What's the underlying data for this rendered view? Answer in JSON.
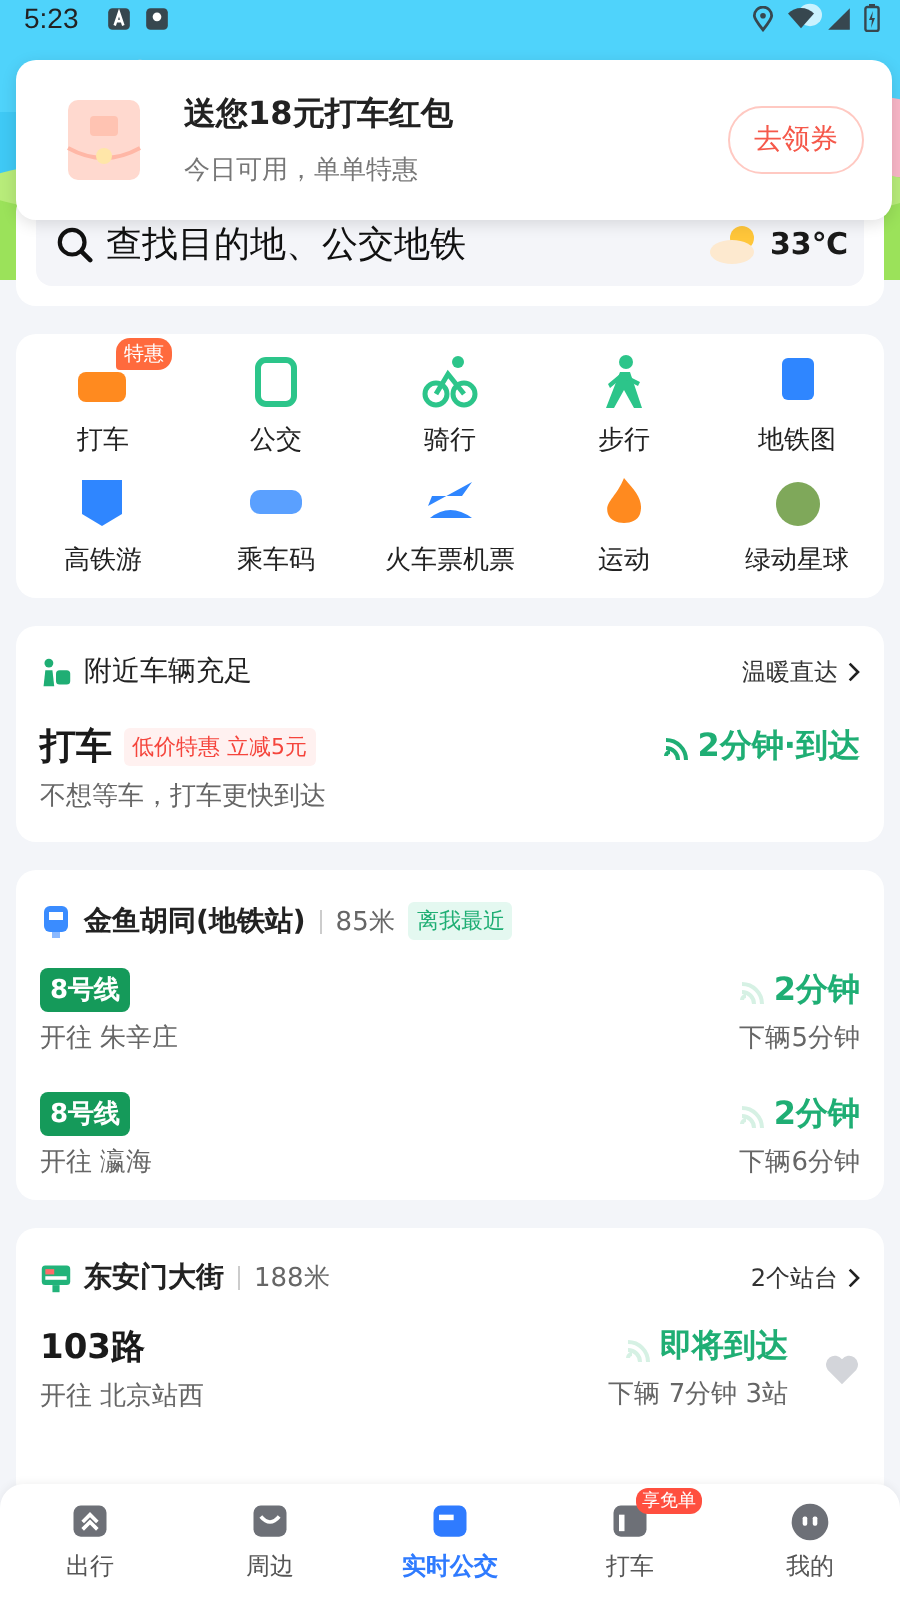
{
  "status_bar": {
    "time": "5:23"
  },
  "notification": {
    "title": "送您18元打车红包",
    "subtitle": "今日可用，单单特惠",
    "button": "去领券"
  },
  "search": {
    "placeholder": "查找目的地、公交地铁",
    "temperature": "33℃"
  },
  "services": [
    {
      "label": "打车",
      "badge": "特惠"
    },
    {
      "label": "公交"
    },
    {
      "label": "骑行"
    },
    {
      "label": "步行"
    },
    {
      "label": "地铁图"
    },
    {
      "label": "高铁游"
    },
    {
      "label": "乘车码"
    },
    {
      "label": "火车票机票"
    },
    {
      "label": "运动"
    },
    {
      "label": "绿动星球"
    }
  ],
  "nearby": {
    "title": "附近车辆充足",
    "link": "温暖直达",
    "item": "打车",
    "tag": "低价特惠 立减5元",
    "description": "不想等车，打车更快到达",
    "eta": "2分钟·到达"
  },
  "station": {
    "name": "金鱼胡同(地铁站)",
    "distance": "85米",
    "tag": "离我最近",
    "lines": [
      {
        "line": "8号线",
        "destination": "开往 朱辛庄",
        "eta": "2分钟",
        "next": "下辆5分钟"
      },
      {
        "line": "8号线",
        "destination": "开往 瀛海",
        "eta": "2分钟",
        "next": "下辆6分钟"
      }
    ]
  },
  "bus_stop": {
    "name": "东安门大街",
    "distance": "188米",
    "link": "2个站台",
    "routes": [
      {
        "name": "103路",
        "destination": "开往 北京站西",
        "eta": "即将到达",
        "next": "下辆 7分钟 3站",
        "favorite": false
      }
    ]
  },
  "tabs": [
    {
      "label": "出行",
      "selected": false
    },
    {
      "label": "周边",
      "selected": false
    },
    {
      "label": "实时公交",
      "selected": true
    },
    {
      "label": "打车",
      "selected": false,
      "badge": "享免单"
    },
    {
      "label": "我的",
      "selected": false
    }
  ]
}
